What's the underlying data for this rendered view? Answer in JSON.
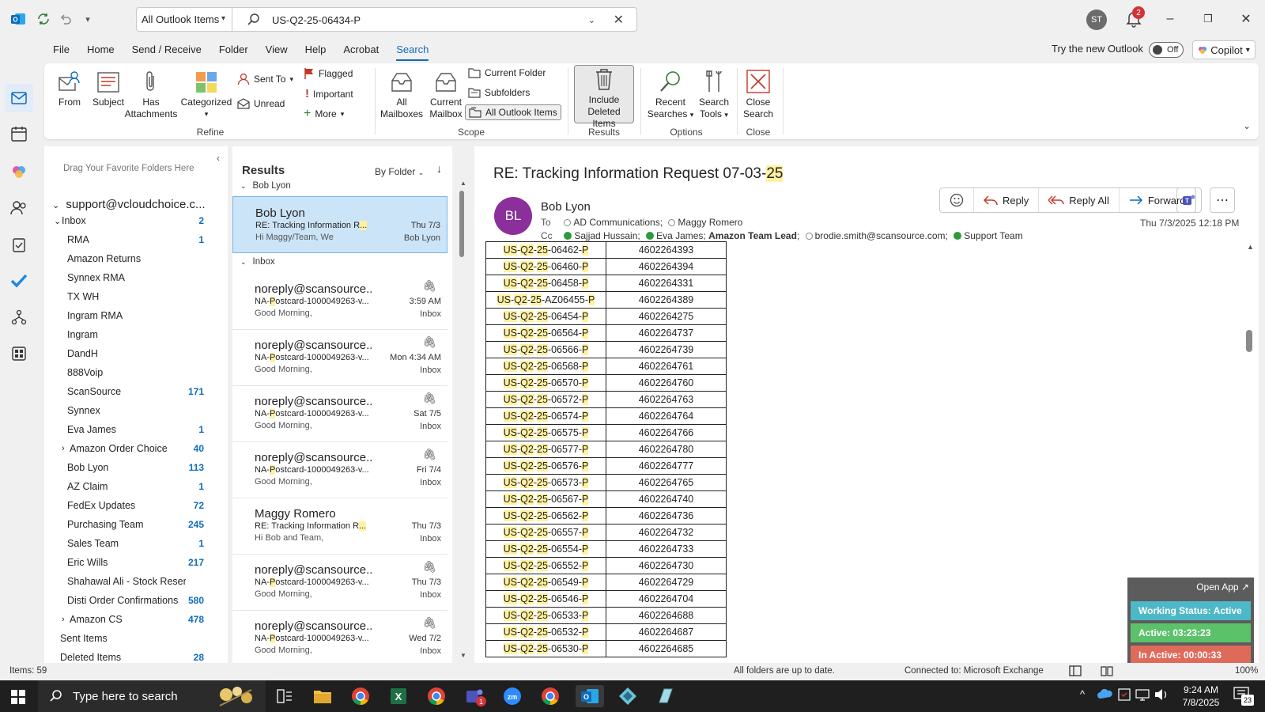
{
  "titlebar": {
    "scope": "All Outlook Items",
    "search_value": "US-Q2-25-06434-P",
    "user_initials": "ST",
    "notification_count": "2"
  },
  "menu": [
    "File",
    "Home",
    "Send / Receive",
    "Folder",
    "View",
    "Help",
    "Acrobat",
    "Search"
  ],
  "menu_active": "Search",
  "try_new": {
    "label": "Try the new Outlook",
    "toggle": "Off"
  },
  "copilot": "Copilot",
  "ribbon": {
    "refine": {
      "from": "From",
      "subject": "Subject",
      "has_attachments_1": "Has",
      "has_attachments_2": "Attachments",
      "categorized": "Categorized",
      "sent_to": "Sent To",
      "unread": "Unread",
      "flagged": "Flagged",
      "important": "Important",
      "more": "More",
      "label": "Refine"
    },
    "scope": {
      "all_mailboxes_1": "All",
      "all_mailboxes_2": "Mailboxes",
      "current_mailbox_1": "Current",
      "current_mailbox_2": "Mailbox",
      "current_folder": "Current Folder",
      "subfolders": "Subfolders",
      "all_items": "All Outlook Items",
      "label": "Scope"
    },
    "results": {
      "include_1": "Include",
      "include_2": "Deleted Items",
      "label": "Results"
    },
    "options": {
      "recent_1": "Recent",
      "recent_2": "Searches",
      "tools_1": "Search",
      "tools_2": "Tools",
      "label": "Options"
    },
    "close": {
      "btn_1": "Close",
      "btn_2": "Search",
      "label": "Close"
    }
  },
  "folderpane": {
    "drag_hint": "Drag Your Favorite Folders Here",
    "account": "support@vcloudchoice.c...",
    "folders": [
      {
        "name": "Inbox",
        "count": "2"
      },
      {
        "name": "RMA",
        "count": "1"
      },
      {
        "name": "Amazon Returns",
        "count": ""
      },
      {
        "name": "Synnex RMA",
        "count": ""
      },
      {
        "name": "TX WH",
        "count": ""
      },
      {
        "name": "Ingram RMA",
        "count": ""
      },
      {
        "name": "Ingram",
        "count": ""
      },
      {
        "name": "DandH",
        "count": ""
      },
      {
        "name": "888Voip",
        "count": ""
      },
      {
        "name": "ScanSource",
        "count": "171"
      },
      {
        "name": "Synnex",
        "count": ""
      },
      {
        "name": "Eva James",
        "count": "1"
      },
      {
        "name": "Amazon Order Choice",
        "count": "40"
      },
      {
        "name": "Bob Lyon",
        "count": "113"
      },
      {
        "name": "AZ Claim",
        "count": "1"
      },
      {
        "name": "FedEx Updates",
        "count": "72"
      },
      {
        "name": "Purchasing Team",
        "count": "245"
      },
      {
        "name": "Sales Team",
        "count": "1"
      },
      {
        "name": "Eric Wills",
        "count": "217"
      },
      {
        "name": "Shahawal Ali - Stock Reservati...",
        "count": ""
      },
      {
        "name": "Disti Order Confirmations",
        "count": "580"
      },
      {
        "name": "Amazon CS",
        "count": "478"
      },
      {
        "name": "Sent Items",
        "count": ""
      },
      {
        "name": "Deleted Items",
        "count": "28"
      }
    ]
  },
  "results": {
    "title": "Results",
    "sort": "By Folder",
    "group_bob": "Bob Lyon",
    "group_inbox": "Inbox",
    "messages": [
      {
        "sender": "Bob Lyon",
        "subject": "RE: Tracking Information R",
        "hl": "...",
        "preview": "Hi Maggy/Team,  We",
        "date": "Thu 7/3",
        "folder": "Bob Lyon"
      },
      {
        "sender": "noreply@scansource....",
        "subject_a": "NA-",
        "hl": "P",
        "subject_b": "ostcard-1000049263-v...",
        "preview": "Good Morning,",
        "date": "3:59 AM",
        "folder": "Inbox"
      },
      {
        "sender": "noreply@scansource....",
        "subject_a": "NA-",
        "hl": "P",
        "subject_b": "ostcard-1000049263-v...",
        "preview": "Good Morning,",
        "date": "Mon 4:34 AM",
        "folder": "Inbox"
      },
      {
        "sender": "noreply@scansource....",
        "subject_a": "NA-",
        "hl": "P",
        "subject_b": "ostcard-1000049263-v...",
        "preview": "Good Morning,",
        "date": "Sat 7/5",
        "folder": "Inbox"
      },
      {
        "sender": "noreply@scansource....",
        "subject_a": "NA-",
        "hl": "P",
        "subject_b": "ostcard-1000049263-v...",
        "preview": "Good Morning,",
        "date": "Fri 7/4",
        "folder": "Inbox"
      },
      {
        "sender": "Maggy Romero",
        "subject": "RE: Tracking Information R",
        "hl": "...",
        "preview": "Hi Bob and Team,",
        "date": "Thu 7/3",
        "folder": "Inbox"
      },
      {
        "sender": "noreply@scansource....",
        "subject_a": "NA-",
        "hl": "P",
        "subject_b": "ostcard-1000049263-v...",
        "preview": "Good Morning,",
        "date": "Thu 7/3",
        "folder": "Inbox"
      },
      {
        "sender": "noreply@scansource....",
        "subject_a": "NA-",
        "hl": "P",
        "subject_b": "ostcard-1000049263-v...",
        "preview": "Good Morning,",
        "date": "Wed 7/2",
        "folder": "Inbox"
      }
    ]
  },
  "reading": {
    "subject_a": "RE: Tracking Information Request  07-03-",
    "subject_hl": "25",
    "avatar": "BL",
    "from": "Bob Lyon",
    "to_label": "To",
    "to_1": "AD Communications;",
    "to_2": "Maggy Romero",
    "cc_label": "Cc",
    "cc_1": "Sajjad Hussain;",
    "cc_2": "Eva James;",
    "cc_3": "Amazon Team Lead",
    "cc_3b": ";",
    "cc_4": "brodie.smith@scansource.com;",
    "cc_5": "Support Team",
    "reply": "Reply",
    "reply_all": "Reply All",
    "forward": "Forward",
    "date": "Thu 7/3/2025 12:18 PM",
    "rows": [
      {
        "a": "US",
        "b": "Q2",
        "c": "25",
        "d": "06462",
        "e": "P",
        "num": "4602264393"
      },
      {
        "a": "US",
        "b": "Q2",
        "c": "25",
        "d": "06460",
        "e": "P",
        "num": "4602264394"
      },
      {
        "a": "US",
        "b": "Q2",
        "c": "25",
        "d": "06458",
        "e": "P",
        "num": "4602264331"
      },
      {
        "a": "US",
        "b": "Q2",
        "c": "25",
        "d": "AZ06455",
        "e": "P",
        "num": "4602264389"
      },
      {
        "a": "US",
        "b": "Q2",
        "c": "25",
        "d": "06454",
        "e": "P",
        "num": "4602264275"
      },
      {
        "a": "US",
        "b": "Q2",
        "c": "25",
        "d": "06564",
        "e": "P",
        "num": "4602264737"
      },
      {
        "a": "US",
        "b": "Q2",
        "c": "25",
        "d": "06566",
        "e": "P",
        "num": "4602264739"
      },
      {
        "a": "US",
        "b": "Q2",
        "c": "25",
        "d": "06568",
        "e": "P",
        "num": "4602264761"
      },
      {
        "a": "US",
        "b": "Q2",
        "c": "25",
        "d": "06570",
        "e": "P",
        "num": "4602264760"
      },
      {
        "a": "US",
        "b": "Q2",
        "c": "25",
        "d": "06572",
        "e": "P",
        "num": "4602264763"
      },
      {
        "a": "US",
        "b": "Q2",
        "c": "25",
        "d": "06574",
        "e": "P",
        "num": "4602264764"
      },
      {
        "a": "US",
        "b": "Q2",
        "c": "25",
        "d": "06575",
        "e": "P",
        "num": "4602264766"
      },
      {
        "a": "US",
        "b": "Q2",
        "c": "25",
        "d": "06577",
        "e": "P",
        "num": "4602264780"
      },
      {
        "a": "US",
        "b": "Q2",
        "c": "25",
        "d": "06576",
        "e": "P",
        "num": "4602264777"
      },
      {
        "a": "US",
        "b": "Q2",
        "c": "25",
        "d": "06573",
        "e": "P",
        "num": "4602264765"
      },
      {
        "a": "US",
        "b": "Q2",
        "c": "25",
        "d": "06567",
        "e": "P",
        "num": "4602264740"
      },
      {
        "a": "US",
        "b": "Q2",
        "c": "25",
        "d": "06562",
        "e": "P",
        "num": "4602264736"
      },
      {
        "a": "US",
        "b": "Q2",
        "c": "25",
        "d": "06557",
        "e": "P",
        "num": "4602264732"
      },
      {
        "a": "US",
        "b": "Q2",
        "c": "25",
        "d": "06554",
        "e": "P",
        "num": "4602264733"
      },
      {
        "a": "US",
        "b": "Q2",
        "c": "25",
        "d": "06552",
        "e": "P",
        "num": "4602264730"
      },
      {
        "a": "US",
        "b": "Q2",
        "c": "25",
        "d": "06549",
        "e": "P",
        "num": "4602264729"
      },
      {
        "a": "US",
        "b": "Q2",
        "c": "25",
        "d": "06546",
        "e": "P",
        "num": "4602264704"
      },
      {
        "a": "US",
        "b": "Q2",
        "c": "25",
        "d": "06533",
        "e": "P",
        "num": "4602264688"
      },
      {
        "a": "US",
        "b": "Q2",
        "c": "25",
        "d": "06532",
        "e": "P",
        "num": "4602264687"
      },
      {
        "a": "US",
        "b": "Q2",
        "c": "25",
        "d": "06530",
        "e": "P",
        "num": "4602264685"
      }
    ]
  },
  "widget": {
    "open": "Open App ↗",
    "status": "Working Status: Active",
    "active": "Active: 03:23:23",
    "inactive": "In Active: 00:00:33"
  },
  "statusbar": {
    "items": "Items: 59",
    "sync": "All folders are up to date.",
    "connected": "Connected to: Microsoft Exchange",
    "zoom": "100%"
  },
  "taskbar": {
    "search_placeholder": "Type here to search",
    "time": "9:24 AM",
    "date": "7/8/2025",
    "notif_count": "23",
    "teams_badge": "1"
  },
  "colors": {
    "accent": "#0f6cbd",
    "highlight": "#fff1a0",
    "avatar": "#8b2f9a",
    "status_active": "#4db8c7",
    "active_green": "#5cc26a",
    "inactive_red": "#e06a5a"
  }
}
